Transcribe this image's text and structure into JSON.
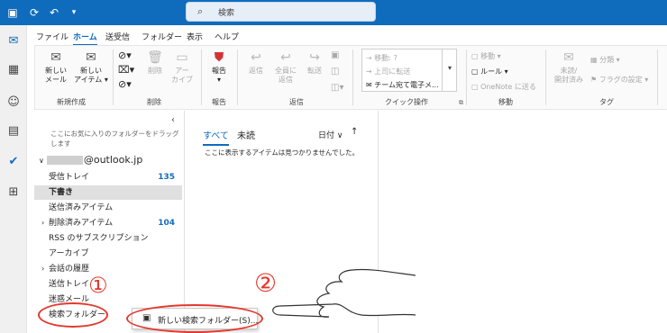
{
  "search": {
    "placeholder": "検索"
  },
  "menu_tabs": [
    "ファイル",
    "ホーム",
    "送受信",
    "フォルダー",
    "表示",
    "ヘルプ"
  ],
  "ribbon": {
    "new_mail": [
      "新しい",
      "メール"
    ],
    "new_item": [
      "新しい",
      "アイテム"
    ],
    "delete": "削除",
    "archive": [
      "アー",
      "カイブ"
    ],
    "report": "報告",
    "reply": "返信",
    "reply_all": [
      "全員に",
      "返信"
    ],
    "forward": "転送",
    "quick_steps": [
      "移動: ?",
      "上司に転送",
      "チーム宛て電子メ..."
    ],
    "move": "移動",
    "rules": "ルール",
    "onenote": "OneNote に送る",
    "unread_read": [
      "未読/",
      "開封済み"
    ],
    "categorize": "分類",
    "flag": "フラグの設定",
    "groups": {
      "new": "新規作成",
      "delete": "削除",
      "report": "報告",
      "respond": "返信",
      "quick_steps": "クイック操作",
      "move": "移動",
      "tags": "タグ"
    }
  },
  "folder_pane": {
    "hint": "ここにお気に入りのフォルダーをドラッグします",
    "account": "@outlook.jp",
    "folders": [
      {
        "label": "受信トレイ",
        "count": "135",
        "expandable": false,
        "selected": false
      },
      {
        "label": "下書き",
        "count": "",
        "expandable": false,
        "selected": true
      },
      {
        "label": "送信済みアイテム",
        "count": "",
        "expandable": false,
        "selected": false
      },
      {
        "label": "削除済みアイテム",
        "count": "104",
        "expandable": true,
        "selected": false
      },
      {
        "label": "RSS のサブスクリプション",
        "count": "",
        "expandable": false,
        "selected": false
      },
      {
        "label": "アーカイブ",
        "count": "",
        "expandable": false,
        "selected": false
      },
      {
        "label": "会話の履歴",
        "count": "",
        "expandable": true,
        "selected": false
      },
      {
        "label": "送信トレイ",
        "count": "",
        "expandable": false,
        "selected": false
      },
      {
        "label": "迷惑メール",
        "count": "",
        "expandable": false,
        "selected": false
      },
      {
        "label": "検索フォルダー",
        "count": "",
        "expandable": false,
        "selected": false
      }
    ]
  },
  "message_list": {
    "tabs": [
      "すべて",
      "未読"
    ],
    "sort": "日付",
    "empty_text": "ここに表示するアイテムは見つかりませんでした。"
  },
  "context_menu": {
    "item": "新しい検索フォルダー(S)..."
  },
  "annotations": {
    "one": "①",
    "two": "②"
  },
  "colors": {
    "accent": "#0f6cbd",
    "annotation": "#e5382e"
  }
}
